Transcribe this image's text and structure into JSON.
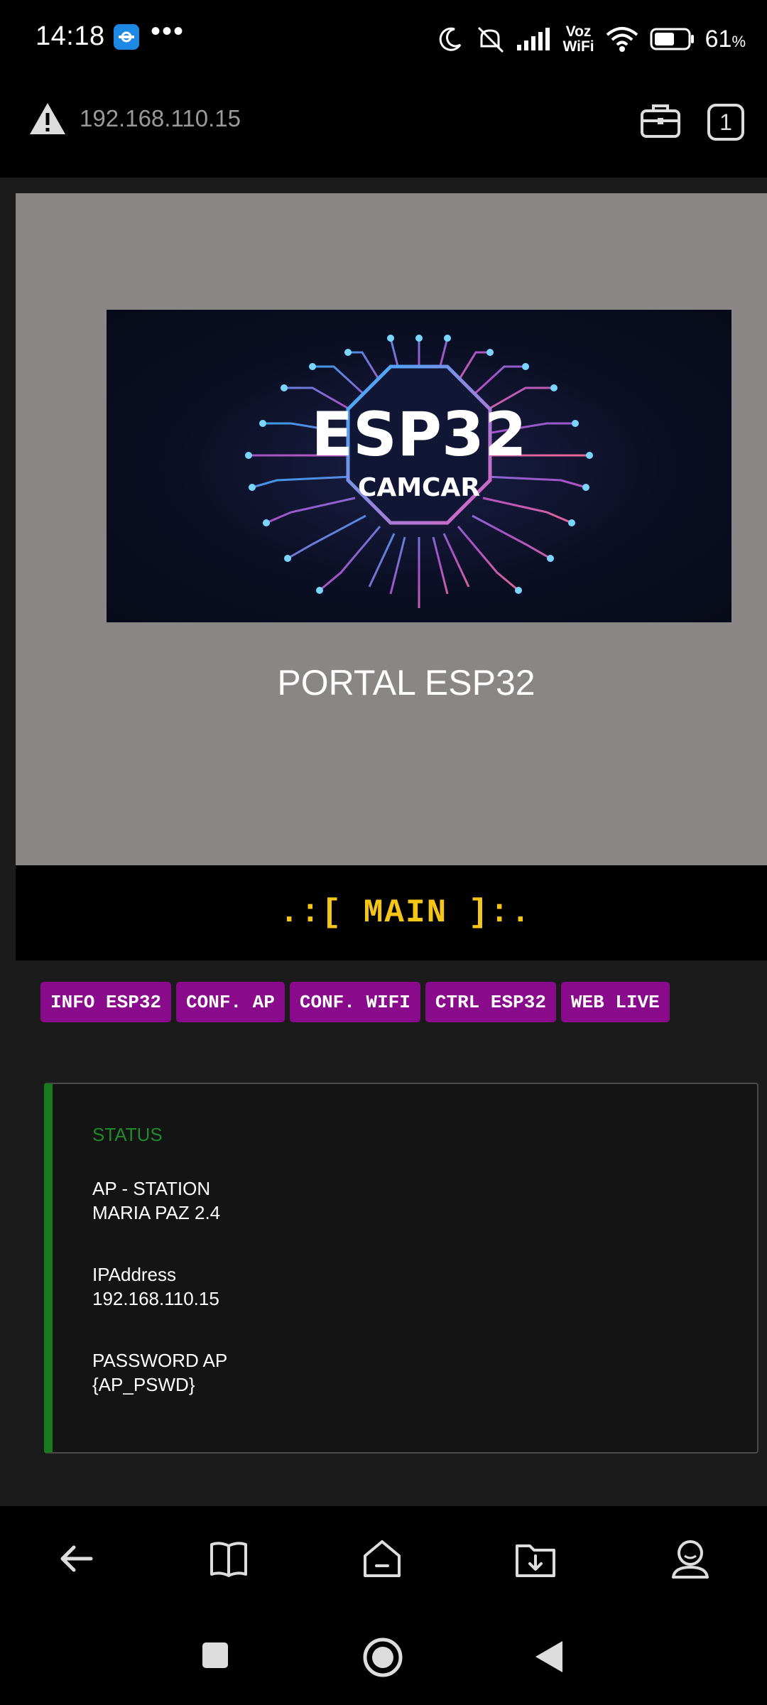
{
  "status_bar": {
    "time": "14:18",
    "more": "•••",
    "voz": "Voz",
    "wifi": "WiFi",
    "battery_level": "61",
    "battery_unit": "%"
  },
  "address_bar": {
    "url": "192.168.110.15",
    "tab_count": "1"
  },
  "hero": {
    "logo_line1": "ESP32",
    "logo_line2": "CAMCAR",
    "title": "PORTAL ESP32"
  },
  "main_header": ".:[ MAIN ]:.",
  "nav_buttons": [
    "INFO ESP32",
    "CONF. AP",
    "CONF. WIFI",
    "CTRL ESP32",
    "WEB LIVE"
  ],
  "status_panel": {
    "title": "STATUS",
    "items": [
      {
        "label": "AP - STATION",
        "value": "MARIA PAZ 2.4"
      },
      {
        "label": "IPAddress",
        "value": "192.168.110.15"
      },
      {
        "label": "PASSWORD AP",
        "value": "{AP_PSWD}"
      }
    ]
  },
  "colors": {
    "accent_button": "#8a0a8c",
    "main_header_text": "#f5c518",
    "status_green": "#177a20",
    "hero_bg": "#8a8686"
  }
}
